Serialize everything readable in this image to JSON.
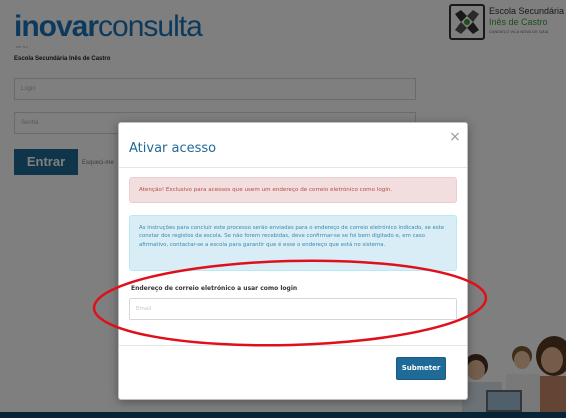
{
  "background": {
    "logo": {
      "bold": "inovar",
      "light": "consulta",
      "tagline": "ver 4.x"
    },
    "school_subtitle": "Escola Secundária Inês de Castro",
    "school_logo": {
      "line1": "Escola Secundária",
      "line2": "Inês de Castro",
      "line3": "CANIDELO VILA NOVA DE GAIA"
    },
    "login_placeholder": "Login",
    "senha_placeholder": "Senha",
    "entrar_label": "Entrar",
    "forgot_label": "Esqueci-me"
  },
  "modal": {
    "title": "Ativar acesso",
    "close_glyph": "×",
    "alert_danger": "Atenção! Exclusivo para acessos que usem um endereço de correio eletrónico como login.",
    "alert_info": "As instruções para concluir este processo serão enviadas para o endereço de correio eletrónico indicado, se este constar dos registos da escola. Se não forem recebidas, deve confirmar-se se foi bem digitado e, em caso afirmativo, contactar-se a escola para garantir que é esse o endereço que está no sistema.",
    "field_label": "Endereço de correio eletrónico a usar como login",
    "field_placeholder": "Email",
    "field_value": "",
    "submit_label": "Submeter"
  },
  "colors": {
    "brand": "#1f6a97",
    "danger_bg": "#f2dede",
    "danger_text": "#b94a48",
    "info_bg": "#d9edf7",
    "info_text": "#3a87ad",
    "annotation": "#e0101a"
  },
  "icons": {
    "close": "close-icon",
    "school": "school-emblem-icon"
  }
}
